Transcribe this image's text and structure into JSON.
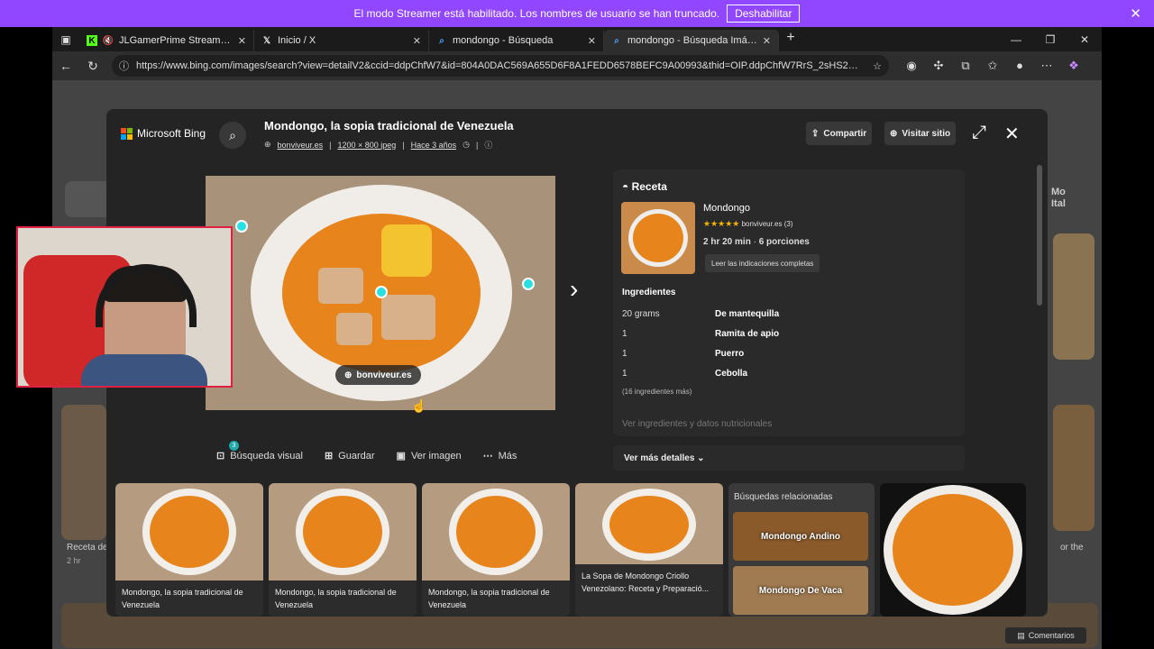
{
  "streamer_bar": {
    "message": "El modo Streamer está habilitado. Los nombres de usuario se han truncado.",
    "disable_label": "Deshabilitar"
  },
  "tabs": [
    {
      "title": "JLGamerPrime Stream - Wat",
      "icon": "kick-icon"
    },
    {
      "title": "Inicio / X",
      "icon": "x-icon"
    },
    {
      "title": "mondongo - Búsqueda",
      "icon": "bing-search-icon"
    },
    {
      "title": "mondongo - Búsqueda Imágenes",
      "icon": "bing-search-icon"
    }
  ],
  "address_bar": {
    "url": "https://www.bing.com/images/search?view=detailV2&ccid=ddpChfW7&id=804A0DAC569A655D6F8A1FEDD6578BEFC9A00993&thid=OIP.ddpChfW7RrS_2sHS2m7..."
  },
  "viewer": {
    "logo_text": "Microsoft Bing",
    "title": "Mondongo, la sopia tradicional de Venezuela",
    "source": "bonviveur.es",
    "dimensions": "1200 × 800 jpeg",
    "age": "Hace 3 años",
    "share_label": "Compartir",
    "visit_label": "Visitar sitio",
    "image_source_pill": "bonviveur.es",
    "actions": {
      "visual_search": "Búsqueda visual",
      "visual_search_badge": "3",
      "save": "Guardar",
      "view_image": "Ver imagen",
      "more": "Más"
    }
  },
  "recipe": {
    "heading": "Receta",
    "name": "Mondongo",
    "stars": "★★★★★",
    "rating_source": "bonviveur.es (3)",
    "time": "2 hr 20 min",
    "portions": "6 porciones",
    "directions_button": "Leer las indicaciones completas",
    "ingredients_heading": "Ingredientes",
    "ingredients": [
      {
        "qty": "20 grams",
        "name": "De mantequilla"
      },
      {
        "qty": "1",
        "name": "Ramita de apio"
      },
      {
        "qty": "1",
        "name": "Puerro"
      },
      {
        "qty": "1",
        "name": "Cebolla"
      }
    ],
    "more_ingredients": "(16 ingredientes más)",
    "nutrition_link": "Ver ingredientes y datos nutricionales",
    "more_details": "Ver más detalles"
  },
  "related_strip": {
    "cards": [
      {
        "caption": "Mondongo, la sopia tradicional de Venezuela"
      },
      {
        "caption": "Mondongo, la sopia tradicional de Venezuela"
      },
      {
        "caption": "Mondongo, la sopia tradicional de Venezuela"
      },
      {
        "caption": "La Sopa de Mondongo Criollo Venezolano: Receta y Preparació..."
      }
    ],
    "related_searches_heading": "Búsquedas relacionadas",
    "related_searches": [
      "Mondongo Andino",
      "Mondongo De Vaca"
    ]
  },
  "background_page": {
    "left_caption": "Receta de",
    "left_sub": "2 hr",
    "right_caption": "or the",
    "right_side_text": "Mo Ital",
    "feedback": "Comentarios"
  }
}
